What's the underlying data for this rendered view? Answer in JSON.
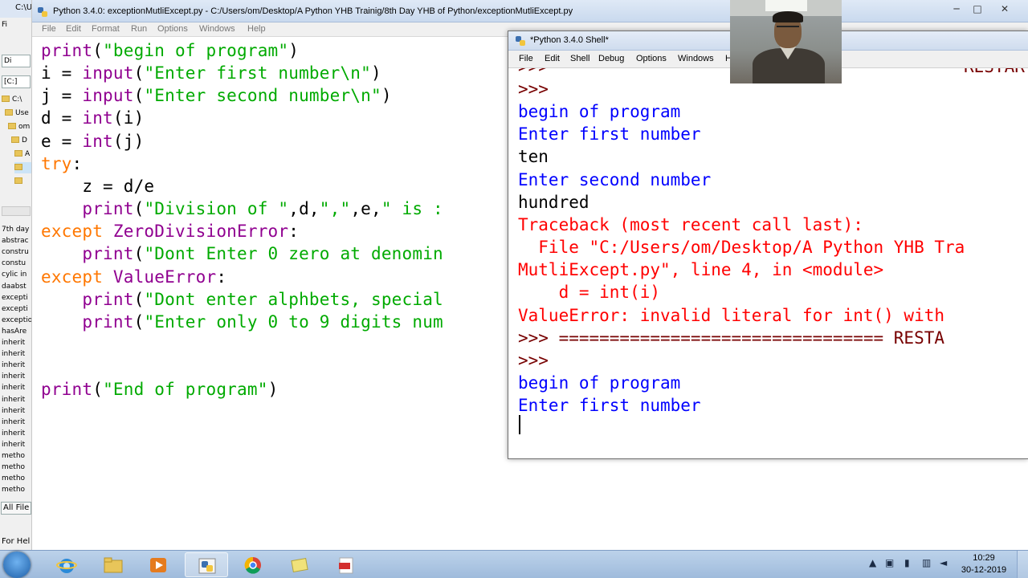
{
  "explorer": {
    "title": "C:\\U",
    "menu_fi": "Fi",
    "dir_label": "Di",
    "drive_box": "[C:]",
    "tree": [
      {
        "label": "C:\\",
        "kind": "folder"
      },
      {
        "label": "Use",
        "kind": "folder"
      },
      {
        "label": "om",
        "kind": "folder"
      },
      {
        "label": "D",
        "kind": "folder"
      },
      {
        "label": "A",
        "kind": "folder"
      },
      {
        "label": "",
        "kind": "folder"
      },
      {
        "label": "",
        "kind": "folder"
      }
    ],
    "files": [
      "7th day",
      "abstrac",
      "constru",
      "constu",
      "cylic in",
      "daabst",
      "excepti",
      "excepti",
      "exceptio",
      "hasAre",
      "inherit",
      "inherit",
      "inherit",
      "inherit",
      "inherit",
      "inherit",
      "inherit",
      "inherit",
      "inherit",
      "inherit",
      "metho",
      "metho",
      "metho",
      "metho"
    ],
    "filter": "All File",
    "status": "For Hel"
  },
  "editor": {
    "title": "Python 3.4.0: exceptionMutliExcept.py - C:/Users/om/Desktop/A Python YHB Trainig/8th Day YHB of Python/exceptionMutliExcept.py",
    "menu": [
      "File",
      "Edit",
      "Format",
      "Run",
      "Options",
      "Windows",
      "Help"
    ],
    "window_controls": {
      "minimize": "─",
      "maximize": "□",
      "close": "✕"
    },
    "code_lines": [
      [
        {
          "t": "print",
          "c": "bi"
        },
        {
          "t": "(",
          "c": "tx"
        },
        {
          "t": "\"begin of program\"",
          "c": "str"
        },
        {
          "t": ")",
          "c": "tx"
        }
      ],
      [
        {
          "t": "i = ",
          "c": "tx"
        },
        {
          "t": "input",
          "c": "bi"
        },
        {
          "t": "(",
          "c": "tx"
        },
        {
          "t": "\"Enter first number\\n\"",
          "c": "str"
        },
        {
          "t": ")",
          "c": "tx"
        }
      ],
      [
        {
          "t": "j = ",
          "c": "tx"
        },
        {
          "t": "input",
          "c": "bi"
        },
        {
          "t": "(",
          "c": "tx"
        },
        {
          "t": "\"Enter second number\\n\"",
          "c": "str"
        },
        {
          "t": ")",
          "c": "tx"
        }
      ],
      [
        {
          "t": "d = ",
          "c": "tx"
        },
        {
          "t": "int",
          "c": "bi"
        },
        {
          "t": "(i)",
          "c": "tx"
        }
      ],
      [
        {
          "t": "e = ",
          "c": "tx"
        },
        {
          "t": "int",
          "c": "bi"
        },
        {
          "t": "(j)",
          "c": "tx"
        }
      ],
      [
        {
          "t": "try",
          "c": "kw"
        },
        {
          "t": ":",
          "c": "tx"
        }
      ],
      [
        {
          "t": "    z = d/e",
          "c": "tx"
        }
      ],
      [
        {
          "t": "    ",
          "c": "tx"
        },
        {
          "t": "print",
          "c": "bi"
        },
        {
          "t": "(",
          "c": "tx"
        },
        {
          "t": "\"Division of \"",
          "c": "str"
        },
        {
          "t": ",d,",
          "c": "tx"
        },
        {
          "t": "\",\"",
          "c": "str"
        },
        {
          "t": ",e,",
          "c": "tx"
        },
        {
          "t": "\" is :",
          "c": "str"
        }
      ],
      [
        {
          "t": "except ",
          "c": "kw"
        },
        {
          "t": "ZeroDivisionError",
          "c": "bi"
        },
        {
          "t": ":",
          "c": "tx"
        }
      ],
      [
        {
          "t": "    ",
          "c": "tx"
        },
        {
          "t": "print",
          "c": "bi"
        },
        {
          "t": "(",
          "c": "tx"
        },
        {
          "t": "\"Dont Enter 0 zero at denomin",
          "c": "str"
        }
      ],
      [
        {
          "t": "except ",
          "c": "kw"
        },
        {
          "t": "ValueError",
          "c": "bi"
        },
        {
          "t": ":",
          "c": "tx"
        }
      ],
      [
        {
          "t": "    ",
          "c": "tx"
        },
        {
          "t": "print",
          "c": "bi"
        },
        {
          "t": "(",
          "c": "tx"
        },
        {
          "t": "\"Dont enter alphbets, special",
          "c": "str"
        }
      ],
      [
        {
          "t": "    ",
          "c": "tx"
        },
        {
          "t": "print",
          "c": "bi"
        },
        {
          "t": "(",
          "c": "tx"
        },
        {
          "t": "\"Enter only 0 to 9 digits num",
          "c": "str"
        }
      ],
      [],
      [],
      [
        {
          "t": "print",
          "c": "bi"
        },
        {
          "t": "(",
          "c": "tx"
        },
        {
          "t": "\"End of program\"",
          "c": "str"
        },
        {
          "t": ")",
          "c": "tx"
        }
      ]
    ]
  },
  "shell": {
    "title": "*Python 3.4.0 Shell*",
    "menu": [
      "File",
      "Edit",
      "Shell",
      "Debug",
      "Options",
      "Windows",
      "H"
    ],
    "partial_top_left": ">>>",
    "partial_top_right": "RESTAR",
    "lines": [
      {
        "t": ">>>",
        "c": "sh-prompt"
      },
      {
        "t": "begin of program",
        "c": "sh-out"
      },
      {
        "t": "Enter first number",
        "c": "sh-out"
      },
      {
        "t": "ten",
        "c": "sh-in"
      },
      {
        "t": "Enter second number",
        "c": "sh-out"
      },
      {
        "t": "hundred",
        "c": "sh-in"
      },
      {
        "t": "Traceback (most recent call last):",
        "c": "sh-err"
      },
      {
        "t": "  File \"C:/Users/om/Desktop/A Python YHB Tra",
        "c": "sh-err"
      },
      {
        "t": "MutliExcept.py\", line 4, in <module>",
        "c": "sh-err"
      },
      {
        "t": "    d = int(i)",
        "c": "sh-err"
      },
      {
        "t": "ValueError: invalid literal for int() with",
        "c": "sh-err"
      },
      {
        "t": ">>> ================================ RESTA",
        "c": "sh-prompt"
      },
      {
        "t": ">>>",
        "c": "sh-prompt"
      },
      {
        "t": "begin of program",
        "c": "sh-out"
      },
      {
        "t": "Enter first number",
        "c": "sh-out"
      }
    ]
  },
  "taskbar": {
    "apps": [
      "windows-explorer",
      "internet-explorer",
      "file-explorer",
      "media-player",
      "python-idle",
      "chrome",
      "notes",
      "pdf"
    ],
    "time": "10:29",
    "date": "30-12-2019"
  },
  "colors": {
    "keyword": "#ff7700",
    "builtin": "#900090",
    "string": "#00aa00",
    "output": "#0000ff",
    "error": "#ff0000",
    "prompt": "#770000"
  }
}
